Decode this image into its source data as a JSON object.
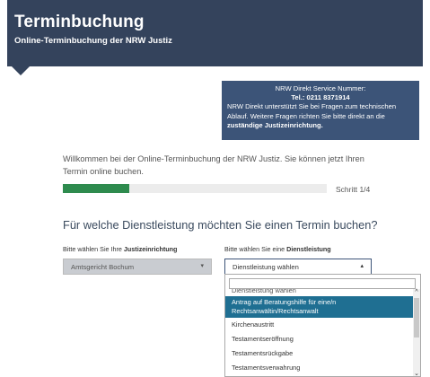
{
  "header": {
    "title": "Terminbuchung",
    "subtitle": "Online-Terminbuchung der NRW Justiz"
  },
  "info_box": {
    "line1": "NRW Direkt Service Nummer:",
    "line2": "Tel.: 0211 8371914",
    "line3": "NRW Direkt unterstützt Sie bei Fragen zum technischen",
    "line4": "Ablauf. Weitere Fragen richten Sie bitte direkt an die",
    "line5": "zuständige Justizeinrichtung."
  },
  "welcome_text": "Willkommen bei der Online-Terminbuchung der NRW Justiz. Sie können jetzt Ihren Termin online buchen.",
  "progress": {
    "fraction": 0.25,
    "step_label": "Schritt 1/4"
  },
  "question": "Für welche Dienstleistung möchten Sie einen Termin buchen?",
  "justice_select": {
    "label_prefix": "Bitte wählen Sie Ihre ",
    "label_bold": "Justizeinrichtung",
    "value": "Amtsgericht Bochum"
  },
  "service_select": {
    "label_prefix": "Bitte wählen Sie eine ",
    "label_bold": "Dienstleistung",
    "value": "Dienstleistung wählen",
    "search_value": ""
  },
  "dropdown_options": [
    "Dienstleistung wählen",
    "Antrag auf Beratungshilfe für eine/n Rechtsanwältin/Rechtsanwalt",
    "Kirchenaustritt",
    "Testamentseröffnung",
    "Testamentsrückgabe",
    "Testamentsverwahrung"
  ]
}
